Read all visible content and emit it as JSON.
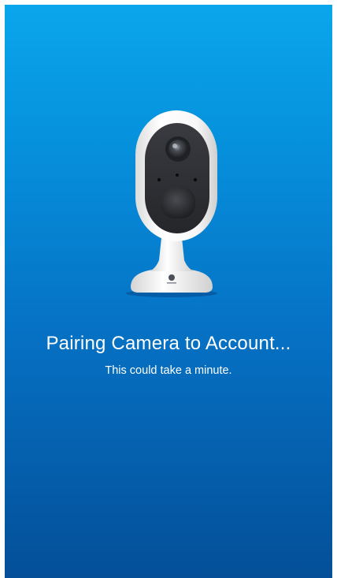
{
  "pairing": {
    "title": "Pairing Camera to Account...",
    "subtitle": "This could take a minute."
  },
  "illustration": {
    "name": "security-camera-illustration"
  },
  "colors": {
    "gradient_top": "#0aa6ec",
    "gradient_bottom": "#044f98",
    "text": "#ffffff",
    "camera_body": "#f4f4f4",
    "camera_face": "#2e2f33"
  }
}
